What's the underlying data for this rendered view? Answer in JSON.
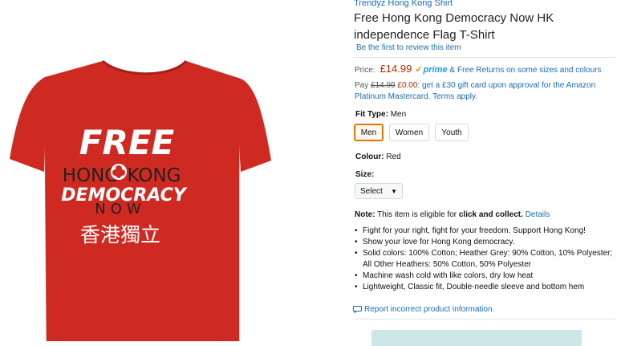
{
  "product": {
    "brand": "Trendyz Hong Kong Shirt",
    "title": "Free Hong Kong Democracy Now HK independence Flag T-Shirt",
    "review_link": "Be the first to review this item",
    "price_label": "Price:",
    "price": "£14.99",
    "prime_label": "prime",
    "free_returns": "& Free Returns on some sizes and colours",
    "gift_pay": "Pay",
    "gift_old_price": "£14.99",
    "gift_new_price": "£0.00",
    "gift_text": ": get a £30 gift card upon approval for the Amazon Platinum Mastercard. Terms apply.",
    "fit_type_label": "Fit Type:",
    "fit_type_value": "Men",
    "fit_options": [
      "Men",
      "Women",
      "Youth"
    ],
    "colour_label": "Colour:",
    "colour_value": "Red",
    "size_label": "Size:",
    "size_select": "Select",
    "note_label": "Note:",
    "note_text": " This item is eligible for ",
    "note_bold": "click and collect.",
    "note_link": "Details",
    "bullets": [
      "Fight for your right, fight for your freedom. Support Hong Kong!",
      "Show your love for Hong Kong democracy.",
      "Solid colors: 100% Cotton; Heather Grey: 90% Cotton, 10% Polyester; All Other Heathers: 50% Cotton, 50% Polyester",
      "Machine wash cold with like colors, dry low heat",
      "Lightweight, Classic fit, Double-needle sleeve and bottom hem"
    ],
    "report_link": "Report incorrect product information."
  },
  "shirt_print": {
    "line1": "FREE",
    "line2a": "HONG",
    "line2b": "KONG",
    "line3": "DEMOCRACY",
    "line4": "NOW",
    "line5": "香港獨立"
  },
  "colors": {
    "shirt": "#cf2a22",
    "link": "#1a6bb8",
    "price": "#b12704",
    "prime": "#1a98ff",
    "selected_border": "#e77600"
  }
}
